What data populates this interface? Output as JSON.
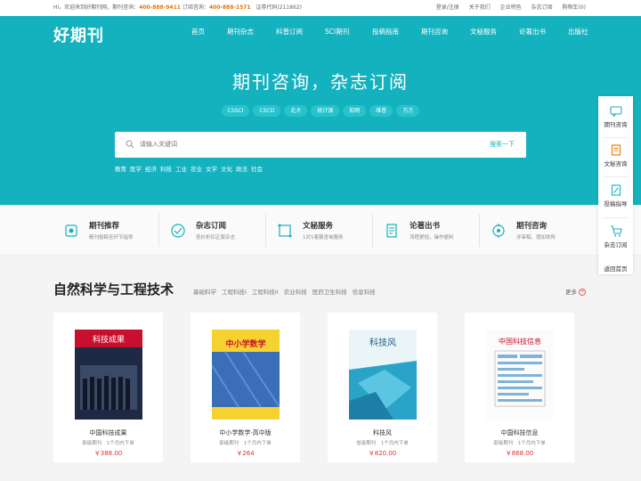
{
  "topbar": {
    "welcome": "Hi，欢迎来到好期刊网，期刊咨询：",
    "phone1": "400-888-9411",
    "subscribe": "订阅咨询：",
    "phone2": "400-888-1571",
    "license": "证券代码(211862)",
    "links": [
      "登录/注册",
      "关于我们",
      "企业特色",
      "杂志订阅",
      "购物车(0)"
    ]
  },
  "logo": "好期刊",
  "nav": [
    "首页",
    "期刊杂志",
    "科普订阅",
    "SCI期刊",
    "投稿指南",
    "期刊咨询",
    "文秘服务",
    "论著出书",
    "出版社"
  ],
  "hero": {
    "title": "期刊咨询，杂志订阅",
    "tags": [
      "CSSCI",
      "CSCD",
      "北大",
      "统计源",
      "知网",
      "维普",
      "万方"
    ]
  },
  "search": {
    "placeholder": "请输入关键词",
    "button": "搜索一下"
  },
  "categories": [
    "教育",
    "医学",
    "经济",
    "科技",
    "工业",
    "农业",
    "文学",
    "文化",
    "政法",
    "社会"
  ],
  "services": [
    {
      "title": "期刊推荐",
      "desc": "精刊投稿全环节指导"
    },
    {
      "title": "杂志订阅",
      "desc": "低价折扣正版杂志"
    },
    {
      "title": "文秘服务",
      "desc": "1对1客服咨询服务"
    },
    {
      "title": "论著出书",
      "desc": "流程更短，操作便利"
    },
    {
      "title": "期刊咨询",
      "desc": "评审稿、增加效所"
    }
  ],
  "sidebar": [
    "期刊咨询",
    "文秘咨询",
    "投稿指导",
    "杂志订阅",
    "返回首页"
  ],
  "section": {
    "title": "自然科学与工程技术",
    "tabs": [
      "基础科学",
      "工程科技I",
      "工程科技II",
      "农业科技",
      "医药卫生科技",
      "信息科技"
    ],
    "more": "更多"
  },
  "products": [
    {
      "name": "中国科技成果",
      "meta": "部级期刊　1个月内下单",
      "price": "￥388.00",
      "cover_text": "科技成果"
    },
    {
      "name": "中小学数学·高中版",
      "meta": "部级期刊　1个月内下单",
      "price": "￥264",
      "cover_text": "中小学数学"
    },
    {
      "name": "科技风",
      "meta": "省级期刊　1个月内下单",
      "price": "￥820.00",
      "cover_text": "科技风"
    },
    {
      "name": "中国科技信息",
      "meta": "部级期刊　1个月内下单",
      "price": "￥868.00",
      "cover_text": "中国科技信息"
    }
  ],
  "colors": {
    "brand": "#14b2be",
    "price": "#e03030",
    "phone": "#e8730c"
  }
}
